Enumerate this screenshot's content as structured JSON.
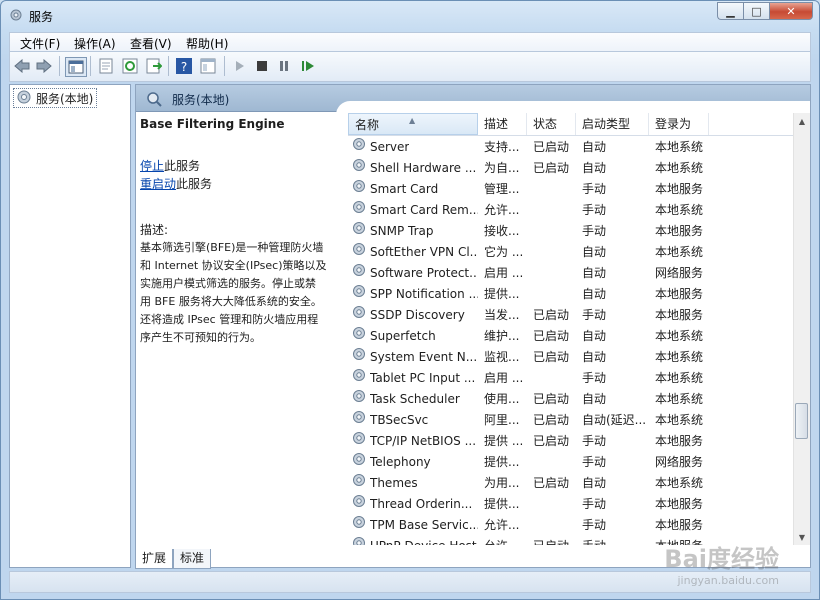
{
  "window": {
    "title": "服务"
  },
  "menu": [
    "文件(F)",
    "操作(A)",
    "查看(V)",
    "帮助(H)"
  ],
  "toolbar": {
    "icons": [
      "back-icon",
      "forward-icon",
      "show-hide-tree-icon",
      "properties-icon",
      "refresh-icon",
      "export-list-icon",
      "help-icon",
      "view-icon",
      "start-service-icon",
      "stop-service-icon",
      "pause-service-icon",
      "resume-service-icon"
    ]
  },
  "tree": {
    "root_label": "服务(本地)"
  },
  "pane": {
    "header": "服务(本地)"
  },
  "details": {
    "service_name": "Base Filtering Engine",
    "stop_link": "停止",
    "stop_suffix": "此服务",
    "restart_link": "重启动",
    "restart_suffix": "此服务",
    "desc_label": "描述:",
    "desc_lines": [
      "基本筛选引擎(BFE)是一种管理防火墙",
      "和 Internet 协议安全(IPsec)策略以及",
      "实施用户模式筛选的服务。停止或禁",
      "用 BFE 服务将大大降低系统的安全。",
      "还将造成 IPsec 管理和防火墙应用程",
      "序产生不可预知的行为。"
    ]
  },
  "columns": [
    "名称",
    "描述",
    "状态",
    "启动类型",
    "登录为"
  ],
  "rows": [
    {
      "name": "Server",
      "desc": "支持...",
      "status": "已启动",
      "start": "自动",
      "logon": "本地系统"
    },
    {
      "name": "Shell Hardware ...",
      "desc": "为自...",
      "status": "已启动",
      "start": "自动",
      "logon": "本地系统"
    },
    {
      "name": "Smart Card",
      "desc": "管理...",
      "status": "",
      "start": "手动",
      "logon": "本地服务"
    },
    {
      "name": "Smart Card Rem...",
      "desc": "允许...",
      "status": "",
      "start": "手动",
      "logon": "本地系统"
    },
    {
      "name": "SNMP Trap",
      "desc": "接收...",
      "status": "",
      "start": "手动",
      "logon": "本地服务"
    },
    {
      "name": "SoftEther VPN Cl...",
      "desc": "它为 ...",
      "status": "",
      "start": "自动",
      "logon": "本地系统"
    },
    {
      "name": "Software Protect...",
      "desc": "启用 ...",
      "status": "",
      "start": "自动",
      "logon": "网络服务"
    },
    {
      "name": "SPP Notification ...",
      "desc": "提供...",
      "status": "",
      "start": "自动",
      "logon": "本地服务"
    },
    {
      "name": "SSDP Discovery",
      "desc": "当发...",
      "status": "已启动",
      "start": "手动",
      "logon": "本地服务"
    },
    {
      "name": "Superfetch",
      "desc": "维护...",
      "status": "已启动",
      "start": "自动",
      "logon": "本地系统"
    },
    {
      "name": "System Event N...",
      "desc": "监视...",
      "status": "已启动",
      "start": "自动",
      "logon": "本地系统"
    },
    {
      "name": "Tablet PC Input ...",
      "desc": "启用 ...",
      "status": "",
      "start": "手动",
      "logon": "本地系统"
    },
    {
      "name": "Task Scheduler",
      "desc": "使用...",
      "status": "已启动",
      "start": "自动",
      "logon": "本地系统"
    },
    {
      "name": "TBSecSvc",
      "desc": "阿里...",
      "status": "已启动",
      "start": "自动(延迟...",
      "logon": "本地系统"
    },
    {
      "name": "TCP/IP NetBIOS ...",
      "desc": "提供 ...",
      "status": "已启动",
      "start": "手动",
      "logon": "本地服务"
    },
    {
      "name": "Telephony",
      "desc": "提供...",
      "status": "",
      "start": "手动",
      "logon": "网络服务"
    },
    {
      "name": "Themes",
      "desc": "为用...",
      "status": "已启动",
      "start": "自动",
      "logon": "本地系统"
    },
    {
      "name": "Thread Orderin...",
      "desc": "提供...",
      "status": "",
      "start": "手动",
      "logon": "本地服务"
    },
    {
      "name": "TPM Base Servic...",
      "desc": "允许...",
      "status": "",
      "start": "手动",
      "logon": "本地服务"
    },
    {
      "name": "UPnP Device Host",
      "desc": "允许...",
      "status": "已启动",
      "start": "手动",
      "logon": "本地服务"
    }
  ],
  "tabs": [
    "扩展",
    "标准"
  ],
  "watermark": {
    "brand": "Bai度经验",
    "url": "jingyan.baidu.com"
  }
}
